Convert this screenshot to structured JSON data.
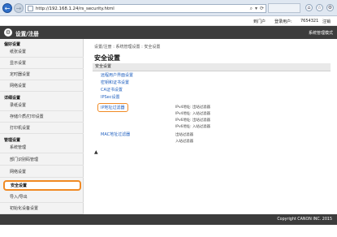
{
  "browser": {
    "url": "http://192.168.1.24/rs_security.html",
    "address_tools": [
      "⌕",
      "▾",
      "⟳"
    ]
  },
  "topbar": {
    "logout": "注销",
    "user_label": "登录用户:",
    "user_value": "7654321",
    "portal": "到门户"
  },
  "header": {
    "logo": "⚙",
    "title": "设置/注册",
    "right_link": "系统管理模式"
  },
  "sidebar": {
    "categories": [
      {
        "label": "偏好设置"
      },
      {
        "label": "详细设置"
      },
      {
        "label": "管理设置"
      }
    ],
    "items_pref": [
      {
        "label": "纸张设置"
      },
      {
        "label": "显示设置"
      },
      {
        "label": "定时器设置"
      },
      {
        "label": "网络设置"
      }
    ],
    "items_detail": [
      {
        "label": "录纸设置"
      },
      {
        "label": "存储介质/打印设置"
      },
      {
        "label": "打印机设置"
      }
    ],
    "items_admin": [
      {
        "label": "系统管理"
      },
      {
        "label": "部门识别码管理"
      },
      {
        "label": "网络设置"
      },
      {
        "label": "安全设置"
      },
      {
        "label": "导入/导出"
      },
      {
        "label": "初始化设备设置"
      }
    ]
  },
  "main": {
    "breadcrumb": "设置/注册 : 系统管理设置 : 安全设置",
    "title": "安全设置",
    "section": "安全设置",
    "links": [
      {
        "label": "远程用户界面设置"
      },
      {
        "label": "密钥和证书设置"
      },
      {
        "label": "CA证书设置"
      },
      {
        "label": "IPSec设置"
      },
      {
        "label": "IP地址过滤器"
      },
      {
        "label": "MAC地址过滤器"
      }
    ],
    "ip_filter_values": [
      "IPv4地址: 出站过滤器",
      "IPv4地址: 入站过滤器",
      "IPv6地址: 出站过滤器",
      "IPv6地址: 入站过滤器"
    ],
    "mac_filter_values": [
      "出站过滤器",
      "入站过滤器"
    ],
    "top_icon": "▲"
  },
  "footer": {
    "copyright": "Copyright CANON INC. 2015"
  }
}
